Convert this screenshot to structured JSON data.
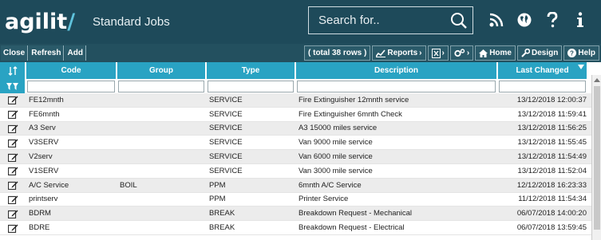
{
  "header": {
    "logo_main": "agilit",
    "logo_tail": "/",
    "title": "Standard Jobs",
    "search_placeholder": "Search for..",
    "icons": [
      "rss-icon",
      "globe-icon",
      "help-icon",
      "info-icon"
    ]
  },
  "toolbar": {
    "close": "Close",
    "refresh": "Refresh",
    "add": "Add",
    "rows": "( total 38 rows )",
    "reports": "Reports",
    "home": "Home",
    "design": "Design",
    "help": "Help"
  },
  "grid": {
    "columns": [
      "Code",
      "Group",
      "Type",
      "Description",
      "Last Changed"
    ],
    "rows": [
      {
        "code": "FE12mnth",
        "group": "",
        "type": "SERVICE",
        "description": "Fire Extinguisher 12mnth service",
        "changed": "13/12/2018 12:00:37"
      },
      {
        "code": "FE6mnth",
        "group": "",
        "type": "SERVICE",
        "description": "Fire Extinguisher 6mnth Check",
        "changed": "13/12/2018 11:59:41"
      },
      {
        "code": "A3 Serv",
        "group": "",
        "type": "SERVICE",
        "description": "A3 15000 miles service",
        "changed": "13/12/2018 11:56:25"
      },
      {
        "code": "V3SERV",
        "group": "",
        "type": "SERVICE",
        "description": "Van 9000 mile service",
        "changed": "13/12/2018 11:55:45"
      },
      {
        "code": "V2serv",
        "group": "",
        "type": "SERVICE",
        "description": "Van 6000 mile service",
        "changed": "13/12/2018 11:54:49"
      },
      {
        "code": "V1SERV",
        "group": "",
        "type": "SERVICE",
        "description": "Van 3000 mile service",
        "changed": "13/12/2018 11:52:04"
      },
      {
        "code": "A/C Service",
        "group": "BOIL",
        "type": "PPM",
        "description": "6mnth A/C Service",
        "changed": "12/12/2018 16:23:33"
      },
      {
        "code": "printserv",
        "group": "",
        "type": "PPM",
        "description": "Printer Service",
        "changed": "11/12/2018 11:54:34"
      },
      {
        "code": "BDRM",
        "group": "",
        "type": "BREAK",
        "description": "Breakdown Request - Mechanical",
        "changed": "06/07/2018 14:00:20"
      },
      {
        "code": "BDRE",
        "group": "",
        "type": "BREAK",
        "description": "Breakdown Request - Electrical",
        "changed": "06/07/2018 13:59:45"
      }
    ]
  },
  "colors": {
    "header_bg": "#1e4a5a",
    "toolbar_bg": "#23505f",
    "column_header": "#29a3c3"
  }
}
